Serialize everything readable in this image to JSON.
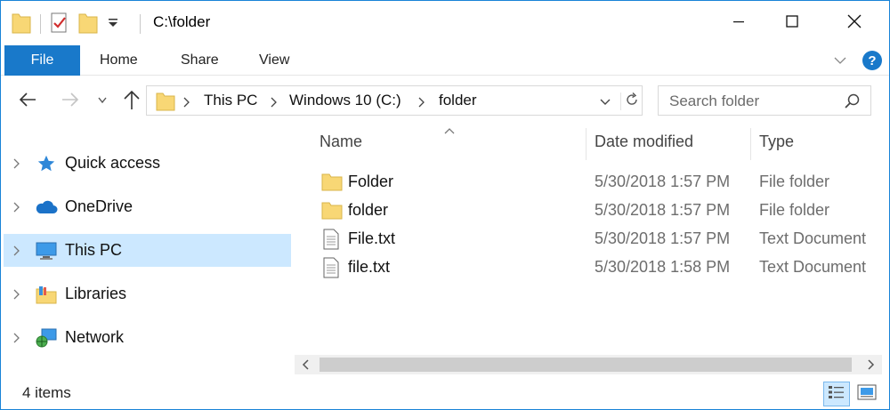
{
  "titlebar": {
    "title": "C:\\folder",
    "icons": [
      "folder-icon",
      "properties-icon",
      "new-folder-icon",
      "customize-quick-access-icon"
    ],
    "controls": [
      "minimize-icon",
      "maximize-icon",
      "close-icon"
    ]
  },
  "ribbon": {
    "tabs": {
      "file": "File",
      "home": "Home",
      "share": "Share",
      "view": "View"
    },
    "help_label": "?",
    "accent_color": "#1979ca"
  },
  "navigation": {
    "breadcrumbs": [
      "This PC",
      "Windows 10 (C:)",
      "folder"
    ]
  },
  "search": {
    "placeholder": "Search folder"
  },
  "sidebar": {
    "items": [
      {
        "label": "Quick access",
        "icon": "star-icon"
      },
      {
        "label": "OneDrive",
        "icon": "cloud-icon"
      },
      {
        "label": "This PC",
        "icon": "computer-icon",
        "selected": true
      },
      {
        "label": "Libraries",
        "icon": "libraries-icon"
      },
      {
        "label": "Network",
        "icon": "network-icon"
      }
    ],
    "selected_color": "#cce8ff"
  },
  "file_list": {
    "columns": [
      "Name",
      "Date modified",
      "Type"
    ],
    "sorted_by": "Name",
    "rows": [
      {
        "name": "Folder",
        "date": "5/30/2018 1:57 PM",
        "type": "File folder",
        "icon": "folder-icon"
      },
      {
        "name": "folder",
        "date": "5/30/2018 1:57 PM",
        "type": "File folder",
        "icon": "folder-icon"
      },
      {
        "name": "File.txt",
        "date": "5/30/2018 1:57 PM",
        "type": "Text Document",
        "icon": "text-document-icon"
      },
      {
        "name": "file.txt",
        "date": "5/30/2018 1:58 PM",
        "type": "Text Document",
        "icon": "text-document-icon"
      }
    ]
  },
  "statusbar": {
    "item_count": "4 items",
    "views": [
      "details-view-icon",
      "large-icons-view-icon"
    ]
  }
}
